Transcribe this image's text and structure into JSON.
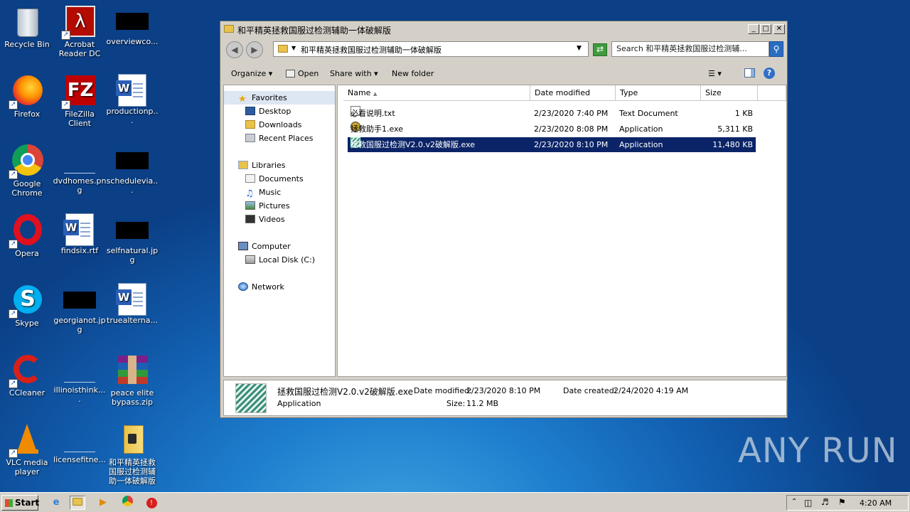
{
  "desktop_icons": [
    {
      "label": "Recycle Bin",
      "icon": "recycle-bin-icon"
    },
    {
      "label": "Acrobat Reader DC",
      "icon": "acrobat-icon"
    },
    {
      "label": "overviewco...",
      "icon": "file-thumbnail-icon"
    },
    {
      "label": "Firefox",
      "icon": "firefox-icon"
    },
    {
      "label": "FileZilla Client",
      "icon": "filezilla-icon"
    },
    {
      "label": "productionp...",
      "icon": "word-doc-icon"
    },
    {
      "label": "Google Chrome",
      "icon": "chrome-icon"
    },
    {
      "label": "dvdhomes.png",
      "icon": "image-file-icon"
    },
    {
      "label": "schedulevia...",
      "icon": "file-thumbnail-icon"
    },
    {
      "label": "Opera",
      "icon": "opera-icon"
    },
    {
      "label": "findsix.rtf",
      "icon": "word-doc-icon"
    },
    {
      "label": "selfnatural.jpg",
      "icon": "file-thumbnail-icon"
    },
    {
      "label": "Skype",
      "icon": "skype-icon"
    },
    {
      "label": "georgianot.jpg",
      "icon": "file-thumbnail-icon"
    },
    {
      "label": "truealterna...",
      "icon": "word-doc-icon"
    },
    {
      "label": "CCleaner",
      "icon": "ccleaner-icon"
    },
    {
      "label": "illinoisthink....",
      "icon": "image-file-icon"
    },
    {
      "label": "peace elite bypass.zip",
      "icon": "winrar-icon"
    },
    {
      "label": "VLC media player",
      "icon": "vlc-icon"
    },
    {
      "label": "licensefitne...",
      "icon": "image-file-icon"
    },
    {
      "label": "和平精英拯救国服过检测辅助一体破解版",
      "icon": "folder-icon"
    }
  ],
  "window": {
    "title": "和平精英拯救国服过检测辅助一体破解版",
    "address": "和平精英拯救国服过检测辅助一体破解版",
    "search_placeholder": "Search 和平精英拯救国服过检测辅...",
    "toolbar": {
      "organize": "Organize",
      "open": "Open",
      "share_with": "Share with",
      "new_folder": "New folder"
    },
    "nav": {
      "favorites": "Favorites",
      "desktop": "Desktop",
      "downloads": "Downloads",
      "recent": "Recent Places",
      "libraries": "Libraries",
      "documents": "Documents",
      "music": "Music",
      "pictures": "Pictures",
      "videos": "Videos",
      "computer": "Computer",
      "local_disk": "Local Disk (C:)",
      "network": "Network"
    },
    "columns": {
      "name": "Name",
      "date": "Date modified",
      "type": "Type",
      "size": "Size"
    },
    "files": [
      {
        "name": "必看说明.txt",
        "date": "2/23/2020 7:40 PM",
        "type": "Text Document",
        "size": "1 KB"
      },
      {
        "name": "拯救助手1.exe",
        "date": "2/23/2020 8:08 PM",
        "type": "Application",
        "size": "5,311 KB"
      },
      {
        "name": "拯救国服过检测V2.0.v2破解版.exe",
        "date": "2/23/2020 8:10 PM",
        "type": "Application",
        "size": "11,480 KB"
      }
    ],
    "details": {
      "name": "拯救国服过检测V2.0.v2破解版.exe",
      "type": "Application",
      "modified_label": "Date modified:",
      "modified": "2/23/2020 8:10 PM",
      "created_label": "Date created:",
      "created": "2/24/2020 4:19 AM",
      "size_label": "Size:",
      "size": "11.2 MB"
    }
  },
  "taskbar": {
    "start": "Start",
    "clock": "4:20 AM"
  },
  "watermark": "ANY RUN",
  "colors": {
    "selection": "#0b2467",
    "desktop": "#125fb0"
  }
}
